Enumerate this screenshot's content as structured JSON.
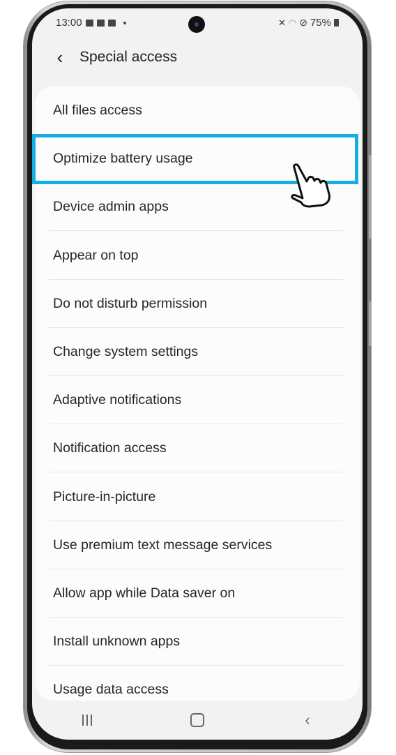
{
  "status_bar": {
    "time": "13:00",
    "battery": "75%",
    "left_icons": [
      "gallery-icon",
      "message-icon",
      "bag-icon",
      "dot-icon"
    ],
    "right_icons": [
      "mute-icon",
      "wifi-icon",
      "do-not-disturb-icon",
      "battery-icon"
    ]
  },
  "header": {
    "back_icon": "‹",
    "title": "Special access"
  },
  "list": {
    "items": [
      {
        "label": "All files access"
      },
      {
        "label": "Optimize battery usage"
      },
      {
        "label": "Device admin apps"
      },
      {
        "label": "Appear on top"
      },
      {
        "label": "Do not disturb permission"
      },
      {
        "label": "Change system settings"
      },
      {
        "label": "Adaptive notifications"
      },
      {
        "label": "Notification access"
      },
      {
        "label": "Picture-in-picture"
      },
      {
        "label": "Use premium text message services"
      },
      {
        "label": "Allow app while Data saver on"
      },
      {
        "label": "Install unknown apps"
      },
      {
        "label": "Usage data access"
      }
    ],
    "highlighted_index": 1
  },
  "annotation": {
    "highlight_color": "#15aee0",
    "pointer": "hand-pointer-icon"
  },
  "nav_bar": {
    "back_glyph": "‹"
  }
}
